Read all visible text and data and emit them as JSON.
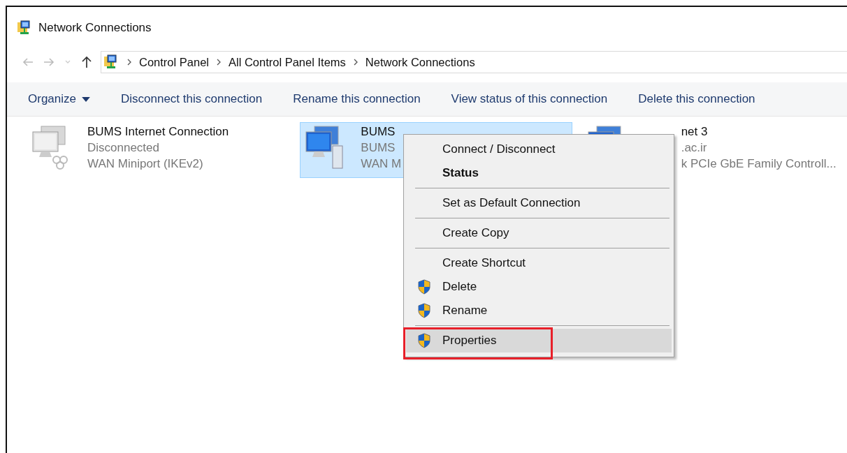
{
  "window": {
    "title": "Network Connections"
  },
  "address_bar": {
    "path": [
      "Control Panel",
      "All Control Panel Items",
      "Network Connections"
    ]
  },
  "command_bar": [
    {
      "label": "Organize",
      "dropdown": true
    },
    {
      "label": "Disconnect this connection",
      "dropdown": false
    },
    {
      "label": "Rename this connection",
      "dropdown": false
    },
    {
      "label": "View status of this connection",
      "dropdown": false
    },
    {
      "label": "Delete this connection",
      "dropdown": false
    }
  ],
  "connections": [
    {
      "name": "BUMS Internet Connection",
      "status": "Disconnected",
      "device": "WAN Miniport (IKEv2)",
      "connected": false,
      "selected": false
    },
    {
      "name": "BUMS",
      "status": "BUMS",
      "device": "WAN M",
      "connected": true,
      "selected": true
    },
    {
      "name": "net 3",
      "status": ".ac.ir",
      "device": "k PCIe GbE Family Controll...",
      "connected": true,
      "selected": false
    }
  ],
  "context_menu": [
    {
      "kind": "item",
      "label": "Connect / Disconnect",
      "bold": false,
      "shield": false,
      "selected": false,
      "outlined": false
    },
    {
      "kind": "item",
      "label": "Status",
      "bold": true,
      "shield": false,
      "selected": false,
      "outlined": false
    },
    {
      "kind": "separator"
    },
    {
      "kind": "item",
      "label": "Set as Default Connection",
      "bold": false,
      "shield": false,
      "selected": false,
      "outlined": false
    },
    {
      "kind": "separator"
    },
    {
      "kind": "item",
      "label": "Create Copy",
      "bold": false,
      "shield": false,
      "selected": false,
      "outlined": false
    },
    {
      "kind": "separator"
    },
    {
      "kind": "item",
      "label": "Create Shortcut",
      "bold": false,
      "shield": false,
      "selected": false,
      "outlined": false
    },
    {
      "kind": "item",
      "label": "Delete",
      "bold": false,
      "shield": true,
      "selected": false,
      "outlined": false
    },
    {
      "kind": "item",
      "label": "Rename",
      "bold": false,
      "shield": true,
      "selected": false,
      "outlined": false
    },
    {
      "kind": "separator"
    },
    {
      "kind": "item",
      "label": "Properties",
      "bold": false,
      "shield": true,
      "selected": true,
      "outlined": true
    }
  ]
}
